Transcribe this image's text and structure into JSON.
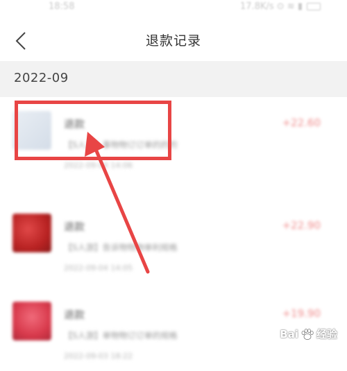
{
  "status_bar": {
    "time": "18:58",
    "right_text": "17.8K/s ⊙ ≋ ▮"
  },
  "nav": {
    "title": "退款记录"
  },
  "section": {
    "date": "2022-09"
  },
  "records": [
    {
      "title": "退款",
      "description": "【S人游】事物物订订单的的的",
      "time": "2022-09-04 14:06",
      "amount": "+22.60"
    },
    {
      "title": "退款",
      "description": "【S人游】告诉物物物单利规格",
      "time": "2022-09-04 14:05",
      "amount": "+22.90"
    },
    {
      "title": "退款",
      "description": "【S人游】单物物订订单的规格",
      "time": "2022-09-03 18:22",
      "amount": "+19.90"
    }
  ],
  "watermark": {
    "brand_text": "Bai",
    "suffix_text": "经验"
  },
  "colors": {
    "annotation_red": "#e84545",
    "section_bg": "#f2f2f2",
    "amount_red": "#ef8a8a"
  },
  "icons": {
    "back": "chevron-left-icon",
    "watermark_logo": "paw-icon"
  }
}
